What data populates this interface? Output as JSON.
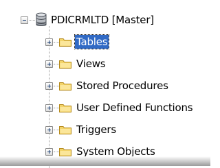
{
  "tree": {
    "root": {
      "label": "PDICRMLTD [Master]",
      "icon": "database-icon",
      "expanded": true
    },
    "children": [
      {
        "label": "Tables",
        "icon": "folder-icon",
        "selected": true
      },
      {
        "label": "Views",
        "icon": "folder-icon",
        "selected": false
      },
      {
        "label": "Stored Procedures",
        "icon": "folder-icon",
        "selected": false
      },
      {
        "label": "User Defined Functions",
        "icon": "folder-icon",
        "selected": false
      },
      {
        "label": "Triggers",
        "icon": "folder-icon",
        "selected": false
      },
      {
        "label": "System Objects",
        "icon": "folder-icon",
        "selected": false
      }
    ]
  },
  "colors": {
    "selection": "#316ac5",
    "folder": "#f3d46a",
    "database": "#9aa0a8"
  }
}
